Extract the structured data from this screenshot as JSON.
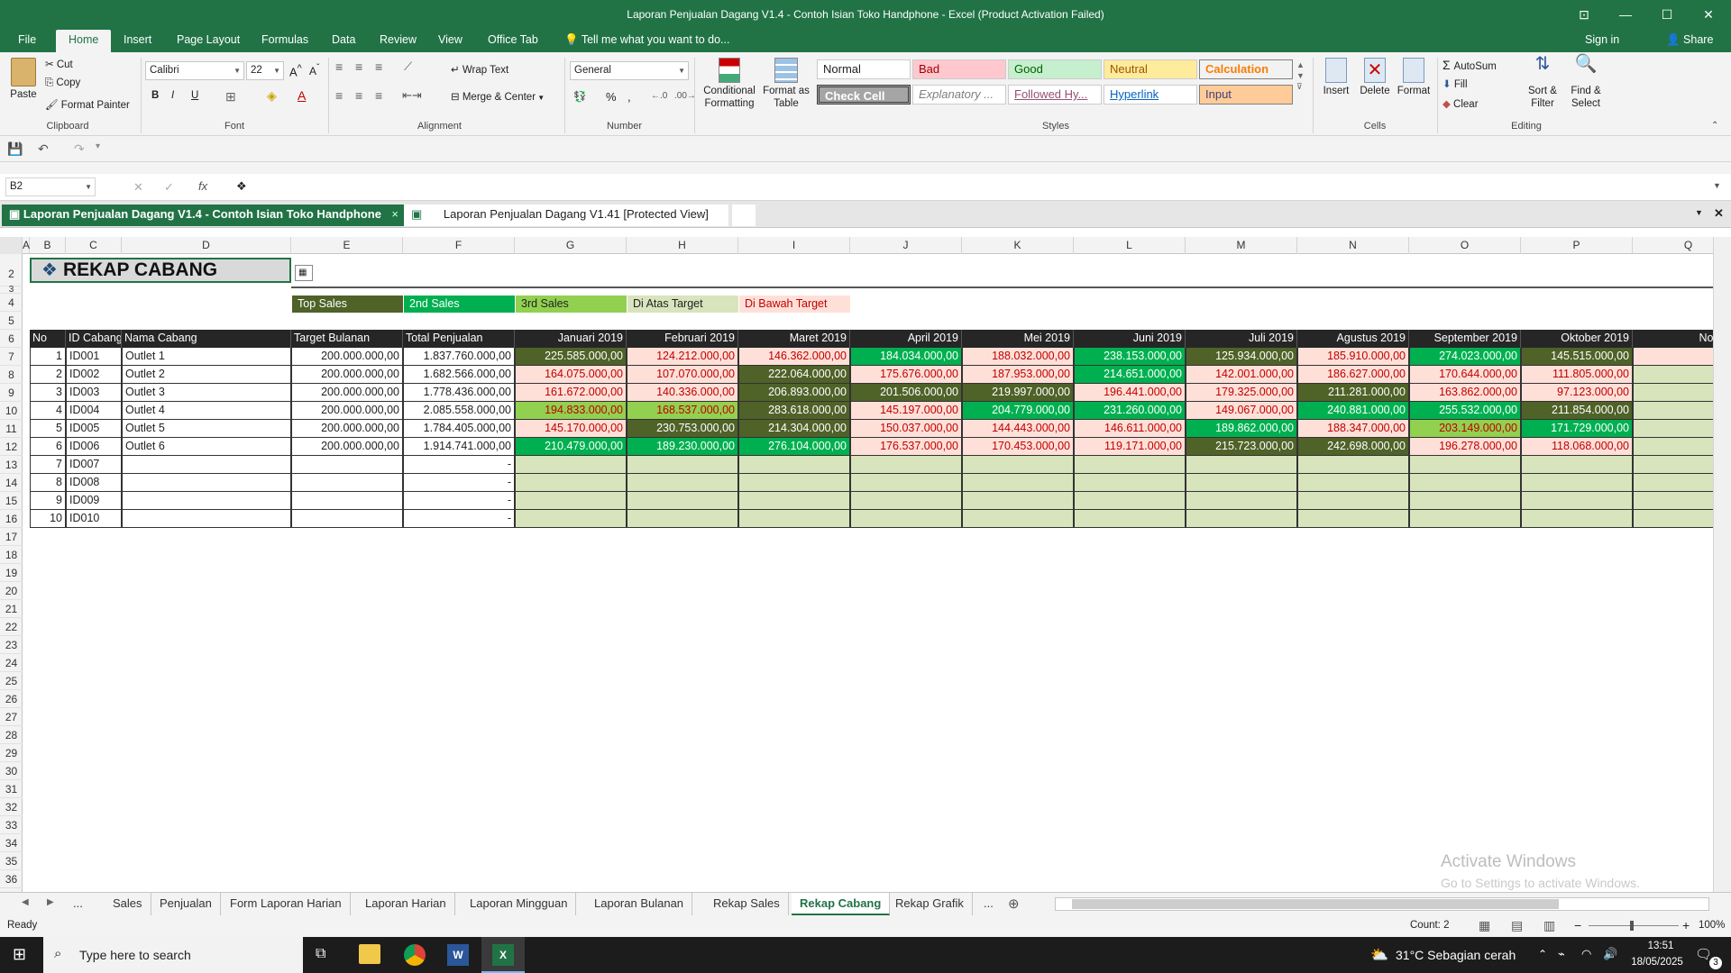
{
  "window": {
    "title": "Laporan Penjualan Dagang V1.4 - Contoh Isian Toko Handphone - Excel (Product Activation Failed)",
    "min": "—",
    "max": "☐",
    "close": "✕",
    "ribbon_opts": "⊡"
  },
  "ribbon_tabs": [
    "File",
    "Home",
    "Insert",
    "Page Layout",
    "Formulas",
    "Data",
    "Review",
    "View",
    "Office Tab"
  ],
  "tell_me": "Tell me what you want to do...",
  "sign_in": "Sign in",
  "share": "Share",
  "clipboard": {
    "paste": "Paste",
    "cut": "Cut",
    "copy": "Copy",
    "format_painter": "Format Painter",
    "label": "Clipboard"
  },
  "font": {
    "name": "Calibri",
    "size": "22",
    "bold": "B",
    "italic": "I",
    "underline": "U",
    "label": "Font"
  },
  "alignment": {
    "wrap": "Wrap Text",
    "merge": "Merge & Center",
    "label": "Alignment"
  },
  "number": {
    "format": "General",
    "label": "Number"
  },
  "styles": {
    "conditional": "Conditional Formatting",
    "format_table": "Format as Table",
    "label": "Styles",
    "cells": [
      {
        "t": "Normal"
      },
      {
        "t": "Bad"
      },
      {
        "t": "Good"
      },
      {
        "t": "Neutral"
      },
      {
        "t": "Calculation"
      },
      {
        "t": "Check Cell"
      },
      {
        "t": "Explanatory ..."
      },
      {
        "t": "Followed Hy..."
      },
      {
        "t": "Hyperlink"
      },
      {
        "t": "Input"
      }
    ]
  },
  "cells_grp": {
    "insert": "Insert",
    "delete": "Delete",
    "format": "Format",
    "label": "Cells"
  },
  "editing": {
    "autosum": "AutoSum",
    "fill": "Fill",
    "clear": "Clear",
    "sort": "Sort & Filter",
    "find": "Find & Select",
    "label": "Editing"
  },
  "namebox": "B2",
  "formula": "❖",
  "workbook_tabs": [
    "Laporan Penjualan Dagang V1.4 - Contoh Isian Toko Handphone",
    "Laporan Penjualan Dagang V1.41  [Protected View]"
  ],
  "columns": [
    "A",
    "B",
    "C",
    "D",
    "E",
    "F",
    "G",
    "H",
    "I",
    "J",
    "K",
    "L",
    "M",
    "N",
    "O",
    "P",
    "Q"
  ],
  "rows": [
    "2",
    "3",
    "4",
    "5",
    "6",
    "7",
    "8",
    "9",
    "10",
    "11",
    "12",
    "13",
    "14",
    "15",
    "16",
    "17",
    "18",
    "19",
    "20",
    "21",
    "22",
    "23",
    "24",
    "25",
    "26",
    "27",
    "28",
    "29",
    "30",
    "31",
    "32",
    "33",
    "34",
    "35",
    "36"
  ],
  "sheet_title": "REKAP CABANG",
  "legend": [
    "Top Sales",
    "2nd Sales",
    "3rd Sales",
    "Di Atas Target",
    "Di Bawah Target"
  ],
  "table_headers": [
    "No",
    "ID Cabang",
    "Nama Cabang",
    "Target Bulanan",
    "Total Penjualan",
    "Januari 2019",
    "Februari 2019",
    "Maret 2019",
    "April 2019",
    "Mei 2019",
    "Juni 2019",
    "Juli 2019",
    "Agustus 2019",
    "September 2019",
    "Oktober 2019",
    "Novemb"
  ],
  "table_rows": [
    [
      "1",
      "ID001",
      "Outlet 1",
      "200.000.000,00",
      "1.837.760.000,00",
      "225.585.000,00",
      "124.212.000,00",
      "146.362.000,00",
      "184.034.000,00",
      "188.032.000,00",
      "238.153.000,00",
      "125.934.000,00",
      "185.910.000,00",
      "274.023.000,00",
      "145.515.000,00"
    ],
    [
      "2",
      "ID002",
      "Outlet 2",
      "200.000.000,00",
      "1.682.566.000,00",
      "164.075.000,00",
      "107.070.000,00",
      "222.064.000,00",
      "175.676.000,00",
      "187.953.000,00",
      "214.651.000,00",
      "142.001.000,00",
      "186.627.000,00",
      "170.644.000,00",
      "111.805.000,00"
    ],
    [
      "3",
      "ID003",
      "Outlet 3",
      "200.000.000,00",
      "1.778.436.000,00",
      "161.672.000,00",
      "140.336.000,00",
      "206.893.000,00",
      "201.506.000,00",
      "219.997.000,00",
      "196.441.000,00",
      "179.325.000,00",
      "211.281.000,00",
      "163.862.000,00",
      "97.123.000,00"
    ],
    [
      "4",
      "ID004",
      "Outlet 4",
      "200.000.000,00",
      "2.085.558.000,00",
      "194.833.000,00",
      "168.537.000,00",
      "283.618.000,00",
      "145.197.000,00",
      "204.779.000,00",
      "231.260.000,00",
      "149.067.000,00",
      "240.881.000,00",
      "255.532.000,00",
      "211.854.000,00"
    ],
    [
      "5",
      "ID005",
      "Outlet 5",
      "200.000.000,00",
      "1.784.405.000,00",
      "145.170.000,00",
      "230.753.000,00",
      "214.304.000,00",
      "150.037.000,00",
      "144.443.000,00",
      "146.611.000,00",
      "189.862.000,00",
      "188.347.000,00",
      "203.149.000,00",
      "171.729.000,00"
    ],
    [
      "6",
      "ID006",
      "Outlet 6",
      "200.000.000,00",
      "1.914.741.000,00",
      "210.479.000,00",
      "189.230.000,00",
      "276.104.000,00",
      "176.537.000,00",
      "170.453.000,00",
      "119.171.000,00",
      "215.723.000,00",
      "242.698.000,00",
      "196.278.000,00",
      "118.068.000,00"
    ],
    [
      "7",
      "ID007",
      "",
      "",
      "-"
    ],
    [
      "8",
      "ID008",
      "",
      "",
      "-"
    ],
    [
      "9",
      "ID009",
      "",
      "",
      "-"
    ],
    [
      "10",
      "ID010",
      "",
      "",
      "-"
    ]
  ],
  "cell_styles": [
    [
      "top",
      "below",
      "below",
      "green",
      "below",
      "green",
      "top",
      "below",
      "green",
      "top",
      "below"
    ],
    [
      "below",
      "below",
      "top",
      "below",
      "below",
      "green",
      "below",
      "below",
      "below",
      "below",
      ""
    ],
    [
      "below",
      "below",
      "top",
      "top",
      "top",
      "below",
      "below",
      "top",
      "below",
      "below",
      ""
    ],
    [
      "light",
      "light",
      "top",
      "below",
      "green",
      "green",
      "below",
      "green",
      "green",
      "top",
      ""
    ],
    [
      "below",
      "top",
      "top",
      "below",
      "below",
      "below",
      "green",
      "below",
      "light",
      "green",
      ""
    ],
    [
      "green",
      "green",
      "green",
      "below",
      "below",
      "below",
      "top",
      "top",
      "below",
      "below",
      ""
    ]
  ],
  "sheet_tabs": [
    "...",
    "Sales",
    "Penjualan",
    "Form Laporan Harian",
    "Laporan Harian",
    "Laporan Mingguan",
    "Laporan Bulanan",
    "Rekap Sales",
    "Rekap Cabang",
    "Rekap Grafik",
    "..."
  ],
  "status": {
    "ready": "Ready",
    "count": "Count: 2",
    "zoom": "100%"
  },
  "watermark": {
    "line1": "Activate Windows",
    "line2": "Go to Settings to activate Windows."
  },
  "taskbar": {
    "search": "Type here to search",
    "weather": "31°C  Sebagian cerah",
    "time": "13:51",
    "date": "18/05/2025",
    "notif": "3"
  },
  "colors": {
    "excel": "#217346",
    "top": "#4f6228",
    "green": "#00b050",
    "light": "#92d050",
    "below_bg": "#ffe0d8",
    "below_fg": "#c00000",
    "empty": "#d8e4bc"
  }
}
